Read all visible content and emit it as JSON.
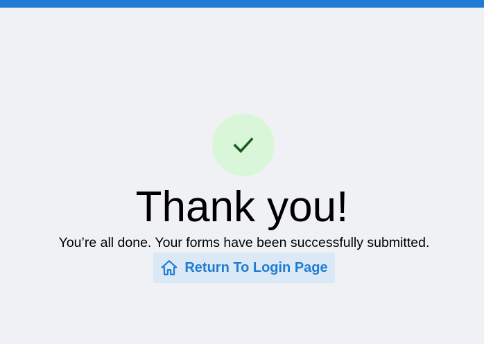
{
  "header": {
    "accent_color": "#1f7bd3"
  },
  "success": {
    "icon": "checkmark-icon",
    "circle_color": "#d9f7d8",
    "check_color": "#1b5e20"
  },
  "confirmation": {
    "title": "Thank you!",
    "message": "You’re all done. Your forms have been successfully submitted."
  },
  "return_button": {
    "icon": "home-icon",
    "label": "Return To Login Page",
    "text_color": "#1f7bd3",
    "background": "#dbe9f6"
  }
}
